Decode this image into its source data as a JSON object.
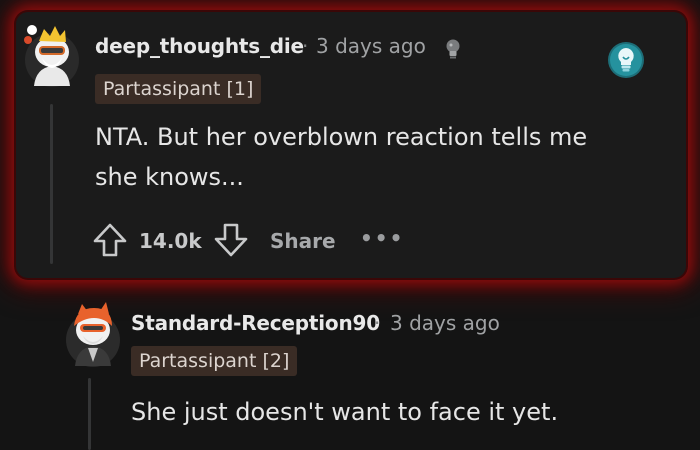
{
  "comments": [
    {
      "username": "deep_thoughts_die",
      "separator": "·",
      "time": "3 days ago",
      "flair": "Partassipant [1]",
      "body_lines": [
        "NTA. But her overblown reaction tells me",
        "she knows..."
      ],
      "vote_count": "14.0k",
      "share_label": "Share",
      "more_label": "•••",
      "award_icon": "lightbulb-icon",
      "status_icon": "bulb-small-icon"
    },
    {
      "username": "Standard-Reception90",
      "separator": "·",
      "time": "3 days ago",
      "flair": "Partassipant [2]",
      "body_lines": [
        "She just doesn't want to face it yet."
      ]
    }
  ],
  "colors": {
    "highlight_glow": "#8e0e0e",
    "flair_bg": "#3a2c25",
    "background": "#141414",
    "card_bg": "#1b1b1b"
  }
}
